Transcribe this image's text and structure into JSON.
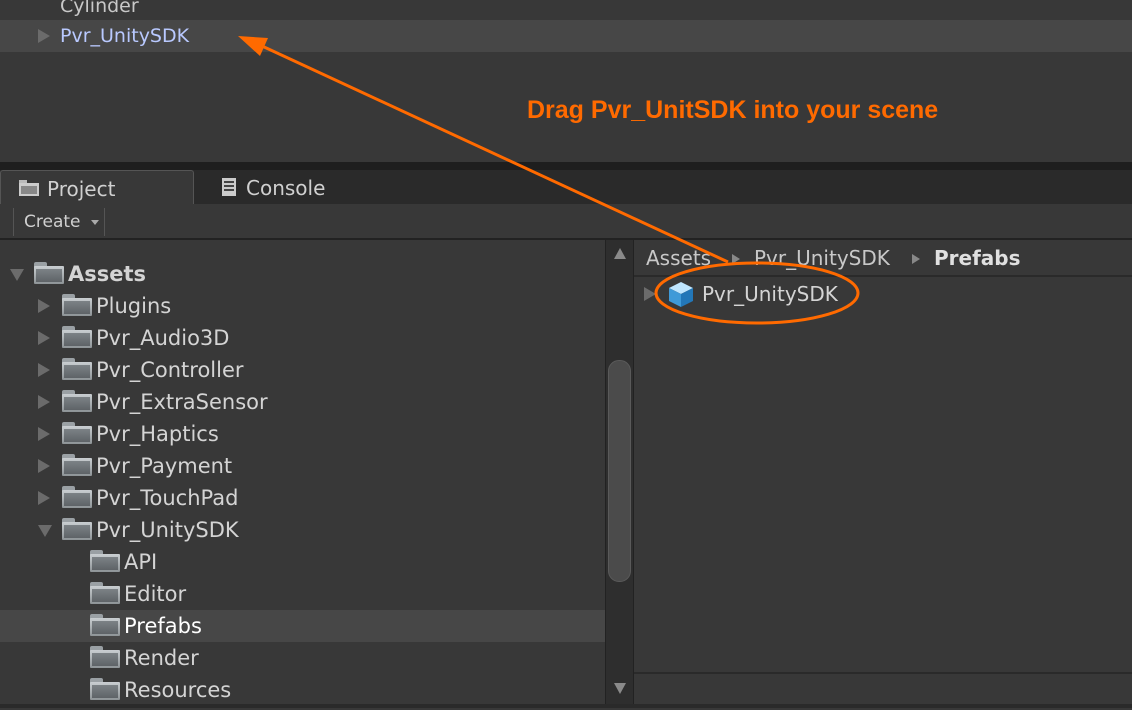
{
  "hierarchy": {
    "items": [
      {
        "label": "Cylinder"
      },
      {
        "label": "Pvr_UnitySDK"
      }
    ]
  },
  "tabs": {
    "project": "Project",
    "console": "Console"
  },
  "toolbar": {
    "create_label": "Create"
  },
  "tree": {
    "items": [
      {
        "label": "Assets"
      },
      {
        "label": "Plugins"
      },
      {
        "label": "Pvr_Audio3D"
      },
      {
        "label": "Pvr_Controller"
      },
      {
        "label": "Pvr_ExtraSensor"
      },
      {
        "label": "Pvr_Haptics"
      },
      {
        "label": "Pvr_Payment"
      },
      {
        "label": "Pvr_TouchPad"
      },
      {
        "label": "Pvr_UnitySDK"
      },
      {
        "label": "API"
      },
      {
        "label": "Editor"
      },
      {
        "label": "Prefabs"
      },
      {
        "label": "Render"
      },
      {
        "label": "Resources"
      }
    ]
  },
  "breadcrumb": [
    "Assets",
    "Pvr_UnitySDK",
    "Prefabs"
  ],
  "assets": [
    {
      "label": "Pvr_UnitySDK",
      "icon": "prefab-cube-icon"
    }
  ],
  "annotation": {
    "text": "Drag Pvr_UnitSDK into your scene",
    "color": "#ff6a00"
  }
}
